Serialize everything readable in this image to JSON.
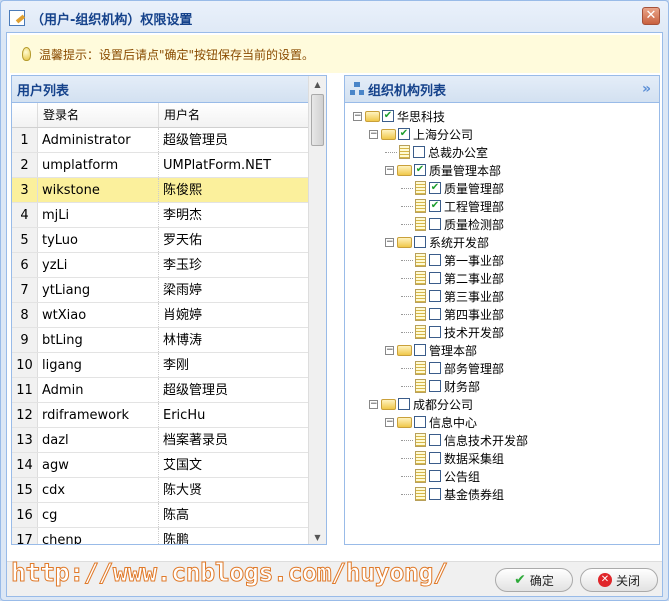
{
  "window": {
    "title": "（用户-组织机构）权限设置",
    "close_label": "✕"
  },
  "hint": "温馨提示：设置后请点\"确定\"按钮保存当前的设置。",
  "users": {
    "title": "用户列表",
    "columns": [
      "",
      "登录名",
      "用户名"
    ],
    "selected_index": 2,
    "rows": [
      [
        "1",
        "Administrator",
        "超级管理员"
      ],
      [
        "2",
        "umplatform",
        "UMPlatForm.NET"
      ],
      [
        "3",
        "wikstone",
        "陈俊熙"
      ],
      [
        "4",
        "mjLi",
        "李明杰"
      ],
      [
        "5",
        "tyLuo",
        "罗天佑"
      ],
      [
        "6",
        "yzLi",
        "李玉珍"
      ],
      [
        "7",
        "ytLiang",
        "梁雨婷"
      ],
      [
        "8",
        "wtXiao",
        "肖婉婷"
      ],
      [
        "9",
        "btLing",
        "林博涛"
      ],
      [
        "10",
        "ligang",
        "李刚"
      ],
      [
        "11",
        "Admin",
        "超级管理员"
      ],
      [
        "12",
        "rdiframework",
        "EricHu"
      ],
      [
        "13",
        "dazl",
        "档案著录员"
      ],
      [
        "14",
        "agw",
        "艾国文"
      ],
      [
        "15",
        "cdx",
        "陈大贤"
      ],
      [
        "16",
        "cg",
        "陈高"
      ],
      [
        "17",
        "chenp",
        "陈鹏"
      ]
    ]
  },
  "org": {
    "title": "组织机构列表",
    "collapse_icon": "double-chevron-right-icon",
    "nodes": [
      {
        "label": "华思科技",
        "level": 0,
        "type": "folder",
        "checked": true
      },
      {
        "label": "上海分公司",
        "level": 1,
        "type": "folder",
        "checked": true
      },
      {
        "label": "总裁办公室",
        "level": 2,
        "type": "leaf",
        "checked": false
      },
      {
        "label": "质量管理本部",
        "level": 2,
        "type": "folder",
        "checked": true
      },
      {
        "label": "质量管理部",
        "level": 3,
        "type": "leaf",
        "checked": true
      },
      {
        "label": "工程管理部",
        "level": 3,
        "type": "leaf",
        "checked": true
      },
      {
        "label": "质量检测部",
        "level": 3,
        "type": "leaf",
        "checked": false
      },
      {
        "label": "系统开发部",
        "level": 2,
        "type": "folder",
        "checked": false
      },
      {
        "label": "第一事业部",
        "level": 3,
        "type": "leaf",
        "checked": false
      },
      {
        "label": "第二事业部",
        "level": 3,
        "type": "leaf",
        "checked": false
      },
      {
        "label": "第三事业部",
        "level": 3,
        "type": "leaf",
        "checked": false
      },
      {
        "label": "第四事业部",
        "level": 3,
        "type": "leaf",
        "checked": false
      },
      {
        "label": "技术开发部",
        "level": 3,
        "type": "leaf",
        "checked": false
      },
      {
        "label": "管理本部",
        "level": 2,
        "type": "folder",
        "checked": false
      },
      {
        "label": "部务管理部",
        "level": 3,
        "type": "leaf",
        "checked": false
      },
      {
        "label": "财务部",
        "level": 3,
        "type": "leaf",
        "checked": false
      },
      {
        "label": "成都分公司",
        "level": 1,
        "type": "folder",
        "checked": false
      },
      {
        "label": "信息中心",
        "level": 2,
        "type": "folder",
        "checked": false
      },
      {
        "label": "信息技术开发部",
        "level": 3,
        "type": "leaf",
        "checked": false
      },
      {
        "label": "数据采集组",
        "level": 3,
        "type": "leaf",
        "checked": false
      },
      {
        "label": "公告组",
        "level": 3,
        "type": "leaf",
        "checked": false
      },
      {
        "label": "基金债券组",
        "level": 3,
        "type": "leaf",
        "checked": false
      }
    ]
  },
  "footer": {
    "watermark": "http://www.cnblogs.com/huyong/",
    "ok_label": "确定",
    "cancel_label": "关闭"
  },
  "colors": {
    "selected_row": "#fbf09c",
    "header_text": "#15428b",
    "hint_bg": "#fffbdc",
    "check": "#1e9e2e"
  }
}
